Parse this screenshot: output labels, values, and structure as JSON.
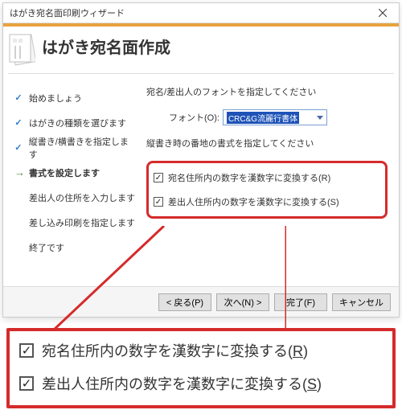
{
  "titlebar": "はがき宛名面印刷ウィザード",
  "header": {
    "title": "はがき宛名面作成"
  },
  "nav": {
    "items": [
      {
        "label": "始めましょう",
        "state": "done"
      },
      {
        "label": "はがきの種類を選びます",
        "state": "done"
      },
      {
        "label": "縦書き/横書きを指定します",
        "state": "done"
      },
      {
        "label": "書式を設定します",
        "state": "current"
      },
      {
        "label": "差出人の住所を入力します",
        "state": "todo"
      },
      {
        "label": "差し込み印刷を指定します",
        "state": "todo"
      },
      {
        "label": "終了です",
        "state": "todo"
      }
    ]
  },
  "content": {
    "heading1": "宛名/差出人のフォントを指定してください",
    "fontLabel": "フォント(O):",
    "fontValue": "CRC&G流麗行書体",
    "heading2": "縦書き時の番地の書式を指定してください",
    "opt1": "宛名住所内の数字を漢数字に変換する(R)",
    "opt2": "差出人住所内の数字を漢数字に変換する(S)"
  },
  "footer": {
    "back": "< 戻る(P)",
    "next": "次へ(N) >",
    "finish": "完了(F)",
    "cancel": "キャンセル"
  },
  "zoom": {
    "line1a": "宛名住所内の数字を漢数字に変換する(",
    "line1b": "R",
    "line1c": ")",
    "line2a": "差出人住所内の数字を漢数字に変換する(",
    "line2b": "S",
    "line2c": ")"
  }
}
